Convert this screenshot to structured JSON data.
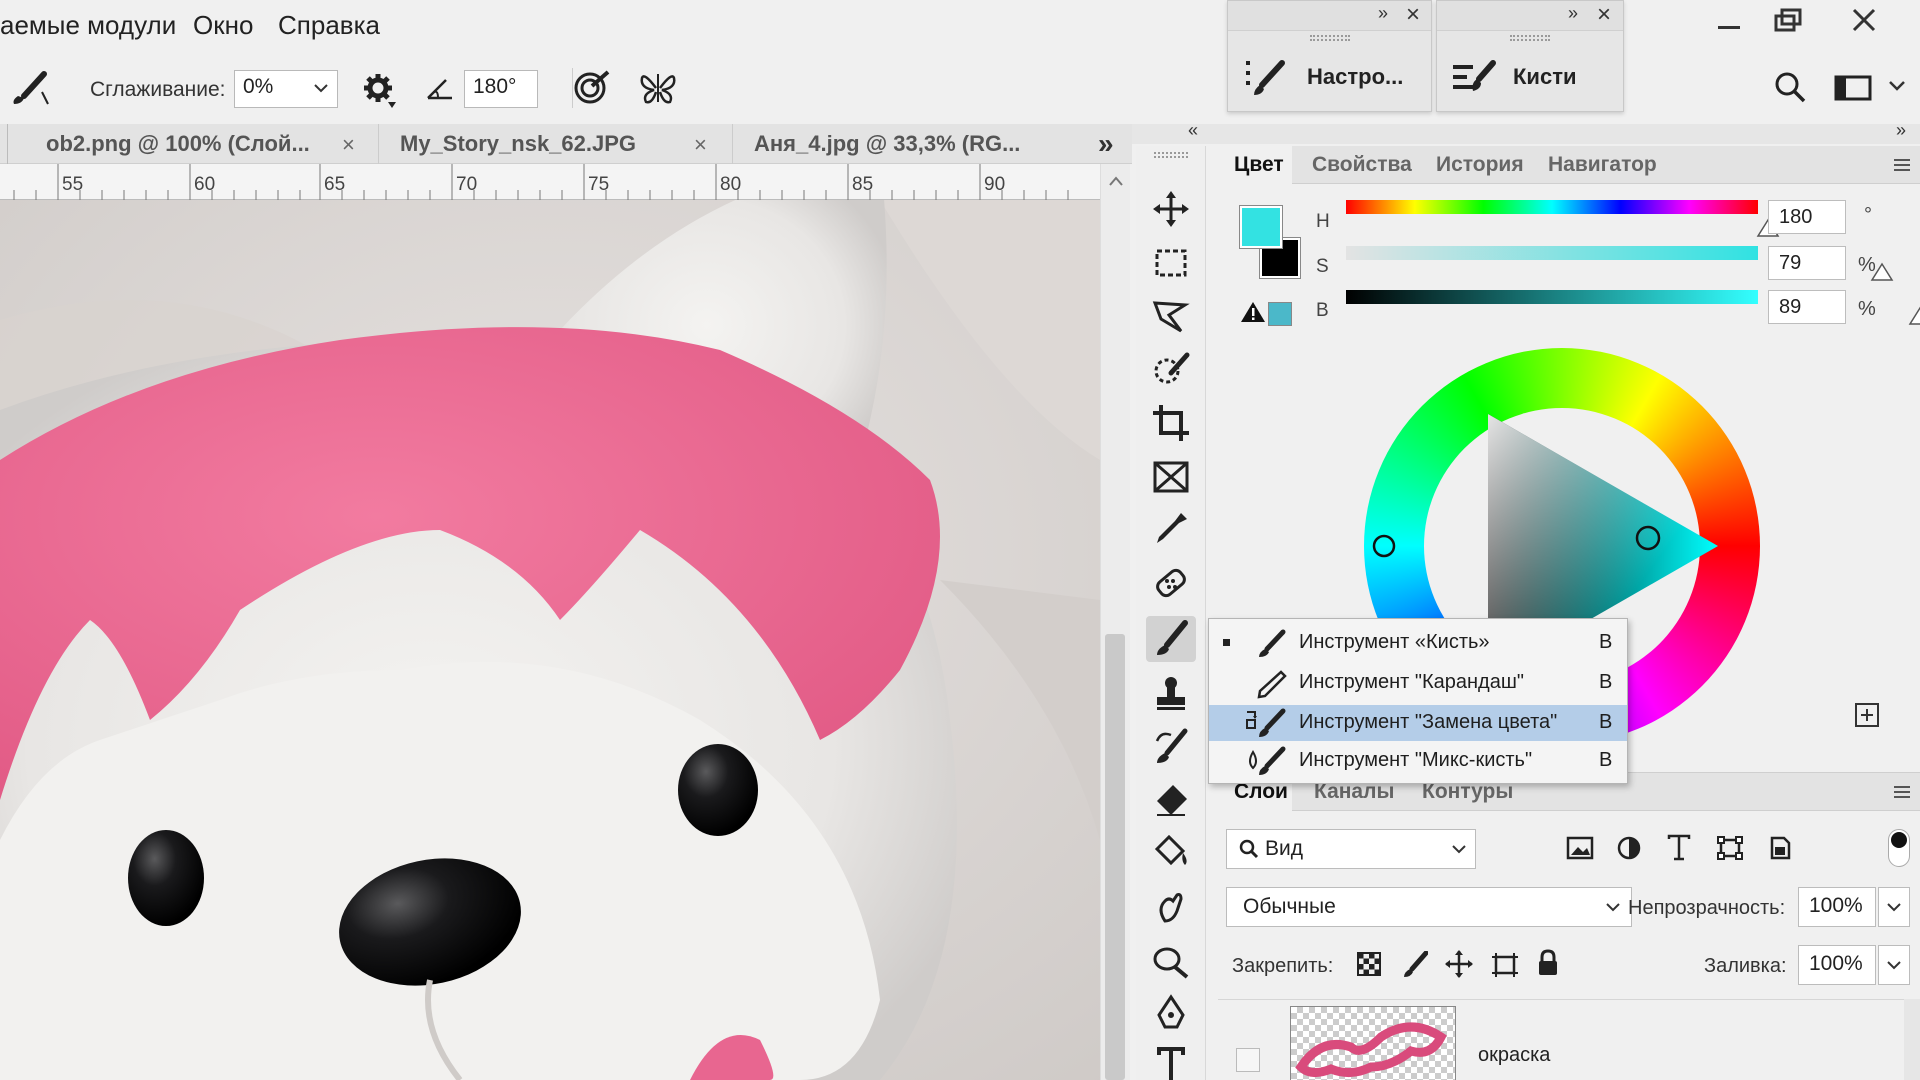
{
  "menu": {
    "items": [
      "аемые модули",
      "Окно",
      "Справка"
    ]
  },
  "mini_panels": [
    {
      "label": "Настро...",
      "icon": "brush-settings-icon"
    },
    {
      "label": "Кисти",
      "icon": "brushes-icon"
    }
  ],
  "options": {
    "smoothing_label": "Сглаживание:",
    "smoothing_value": "0%",
    "angle_value": "180°"
  },
  "tabs": [
    {
      "title": "ob2.png @ 100% (Слой..."
    },
    {
      "title": "My_Story_nsk_62.JPG"
    },
    {
      "title": "Аня_4.jpg @ 33,3% (RG..."
    }
  ],
  "ruler": {
    "ticks": [
      "55",
      "60",
      "65",
      "70",
      "75",
      "80",
      "85",
      "90"
    ]
  },
  "color_panel": {
    "tabs": [
      "Цвет",
      "Свойства",
      "История",
      "Навигатор"
    ],
    "active_tab": "Цвет",
    "h_label": "H",
    "s_label": "S",
    "b_label": "B",
    "h_value": "180",
    "s_value": "79",
    "b_value": "89",
    "h_unit": "°",
    "s_unit": "%",
    "b_unit": "%",
    "foreground_color": "#33e2e2",
    "background_color": "#000000",
    "gamut_warning_color": "#4bb8c9"
  },
  "flyout": {
    "items": [
      {
        "label": "Инструмент «Кисть»",
        "key": "B",
        "icon": "brush-icon",
        "current": true,
        "selected": false
      },
      {
        "label": "Инструмент \"Карандаш\"",
        "key": "B",
        "icon": "pencil-icon",
        "current": false,
        "selected": false
      },
      {
        "label": "Инструмент \"Замена цвета\"",
        "key": "B",
        "icon": "color-replacement-icon",
        "current": false,
        "selected": true
      },
      {
        "label": "Инструмент \"Микс-кисть\"",
        "key": "B",
        "icon": "mixer-brush-icon",
        "current": false,
        "selected": false
      }
    ]
  },
  "layers_panel": {
    "tabs": [
      "Слои",
      "Каналы",
      "Контуры"
    ],
    "active_tab": "Слои",
    "filter_label": "Вид",
    "blend_mode": "Обычные",
    "opacity_label": "Непрозрачность:",
    "opacity_value": "100%",
    "lock_label": "Закрепить:",
    "fill_label": "Заливка:",
    "fill_value": "100%",
    "layer_name": "окраска"
  }
}
